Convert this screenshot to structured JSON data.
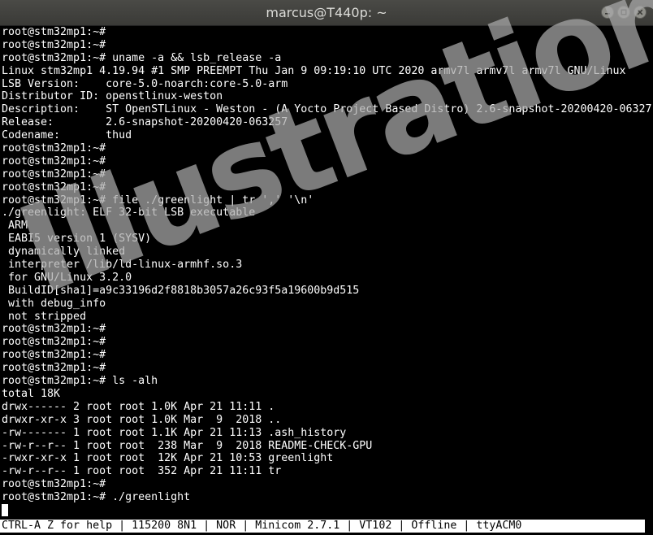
{
  "window": {
    "title": "marcus@T440p: ~",
    "buttons": [
      {
        "name": "minimize",
        "icon": "minimize-icon"
      },
      {
        "name": "maximize",
        "icon": "maximize-icon"
      },
      {
        "name": "close",
        "icon": "close-icon"
      }
    ]
  },
  "terminal": {
    "lines": [
      "root@stm32mp1:~#",
      "root@stm32mp1:~#",
      "root@stm32mp1:~# uname -a && lsb_release -a",
      "Linux stm32mp1 4.19.94 #1 SMP PREEMPT Thu Jan 9 09:19:10 UTC 2020 armv7l armv7l armv7l GNU/Linux",
      "LSB Version:    core-5.0-noarch:core-5.0-arm",
      "Distributor ID: openstlinux-weston",
      "Description:    ST OpenSTLinux - Weston - (A Yocto Project Based Distro) 2.6-snapshot-20200420-06327",
      "Release:        2.6-snapshot-20200420-063257",
      "Codename:       thud",
      "root@stm32mp1:~#",
      "root@stm32mp1:~#",
      "root@stm32mp1:~#",
      "root@stm32mp1:~#",
      "root@stm32mp1:~# file ./greenlight | tr ',' '\\n'",
      "./greenlight: ELF 32-bit LSB executable",
      " ARM",
      " EABI5 version 1 (SYSV)",
      " dynamically linked",
      " interpreter /lib/ld-linux-armhf.so.3",
      " for GNU/Linux 3.2.0",
      " BuildID[sha1]=a9c33196d2f8818b3057a26c93f5a19600b9d515",
      " with debug_info",
      " not stripped",
      "root@stm32mp1:~#",
      "root@stm32mp1:~#",
      "root@stm32mp1:~#",
      "root@stm32mp1:~#",
      "root@stm32mp1:~# ls -alh",
      "total 18K",
      "drwx------ 2 root root 1.0K Apr 21 11:11 .",
      "drwxr-xr-x 3 root root 1.0K Mar  9  2018 ..",
      "-rw------- 1 root root 1.1K Apr 21 11:13 .ash_history",
      "-rw-r--r-- 1 root root  238 Mar  9  2018 README-CHECK-GPU",
      "-rwxr-xr-x 1 root root  12K Apr 21 10:53 greenlight",
      "-rw-r--r-- 1 root root  352 Apr 21 11:11 tr",
      "root@stm32mp1:~#",
      "root@stm32mp1:~# ./greenlight",
      ""
    ]
  },
  "statusbar": {
    "text": "CTRL-A Z for help | 115200 8N1 | NOR | Minicom 2.7.1 | VT102 | Offline | ttyACM0"
  },
  "watermark": {
    "text": "Illustration"
  },
  "colors": {
    "background": "#000000",
    "foreground": "#ffffff",
    "titlebar": "#3f3f3c",
    "statusbar": "#ffffff"
  }
}
